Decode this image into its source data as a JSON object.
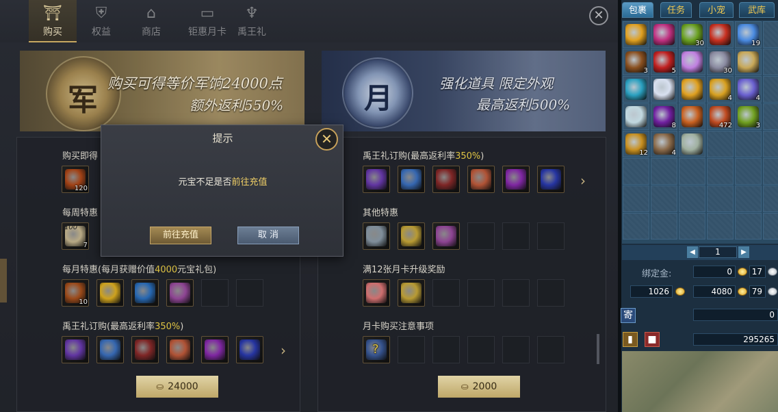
{
  "tabs": [
    {
      "label": "购买",
      "icon": "shop-gate-icon",
      "active": true
    },
    {
      "label": "权益",
      "icon": "shield-icon",
      "active": false
    },
    {
      "label": "商店",
      "icon": "store-icon",
      "active": false
    },
    {
      "label": "钜惠月卡",
      "icon": "card-icon",
      "active": false
    },
    {
      "label": "禹王礼",
      "icon": "trident-icon",
      "active": false
    }
  ],
  "banners": [
    {
      "line1": "购买可得等价军饷24000点",
      "line2": "额外返利550%",
      "glyph": "军"
    },
    {
      "line1": "强化道具 限定外观",
      "line2": "最高返利500%",
      "glyph": "月"
    }
  ],
  "left": {
    "sec1": "购买即得",
    "sec2": "每周特惠",
    "sec3_pre": "每月特惠(每月获赠价值",
    "sec3_hl": "4000",
    "sec3_post": "元宝礼包)",
    "sec4_pre": "禹王礼订购(最高返利率",
    "sec4_hl": "350%",
    "sec4_post": ")",
    "price": "24000",
    "items_r1": [
      {
        "color": "#b04818",
        "count": "120"
      }
    ],
    "items_r2": [
      {
        "color": "#c8b890",
        "count": "7",
        "top": "100"
      }
    ],
    "items_r3": [
      {
        "color": "#a8501c",
        "count": "10"
      },
      {
        "color": "#e0b020",
        "count": ""
      },
      {
        "color": "#2a70c0",
        "count": ""
      },
      {
        "color": "#9a4aa0",
        "count": ""
      }
    ],
    "items_r4": [
      {
        "color": "#6a3ab0"
      },
      {
        "color": "#3a70c0"
      },
      {
        "color": "#8a2a2a"
      },
      {
        "color": "#c05a3a"
      },
      {
        "color": "#8a2ab0"
      },
      {
        "color": "#2a3ab0"
      }
    ]
  },
  "right": {
    "sec1_pre": "禹王礼订购(最高返利率",
    "sec1_hl": "350%",
    "sec1_post": ")",
    "sec2": "其他特惠",
    "sec3": "满12张月卡升级奖励",
    "sec4": "月卡购买注意事项",
    "price": "2000",
    "items_r1": [
      {
        "color": "#6a3ab0"
      },
      {
        "color": "#3a70c0"
      },
      {
        "color": "#8a2a2a"
      },
      {
        "color": "#c05a3a"
      },
      {
        "color": "#8a2ab0"
      },
      {
        "color": "#2a3ab0"
      }
    ],
    "items_r2": [
      {
        "color": "#8a9aa8"
      },
      {
        "color": "#c8a838"
      },
      {
        "color": "#9a4aa0"
      }
    ],
    "items_r3": [
      {
        "color": "#e07878"
      },
      {
        "color": "#c8a838"
      }
    ],
    "items_r4": [
      {
        "color": "#3a5a9a",
        "glyph": "?"
      }
    ]
  },
  "dialog": {
    "title": "提示",
    "msg_pre": "元宝不足是否",
    "msg_hl": "前往充值",
    "ok": "前往充值",
    "cancel": "取 消"
  },
  "side": {
    "tabs": [
      "包裹",
      "任务",
      "小宠",
      "武库"
    ],
    "items": [
      {
        "color": "#e0a020",
        "count": ""
      },
      {
        "color": "#c03080",
        "count": ""
      },
      {
        "color": "#6aa020",
        "count": "30"
      },
      {
        "color": "#c83020",
        "count": ""
      },
      {
        "color": "#4a8ae0",
        "count": "19"
      },
      {
        "color": "#8a5020",
        "count": "3"
      },
      {
        "color": "#c02020",
        "count": "5"
      },
      {
        "color": "#c080e0",
        "count": ""
      },
      {
        "color": "#8a8aa0",
        "count": "30"
      },
      {
        "color": "#c8a858",
        "count": ""
      },
      {
        "color": "#2aa0c0",
        "count": ""
      },
      {
        "color": "#d8e0f0",
        "count": ""
      },
      {
        "color": "#e0a020",
        "count": ""
      },
      {
        "color": "#d8a020",
        "count": "4"
      },
      {
        "color": "#6a60d0",
        "count": "4"
      },
      {
        "color": "#c0d8e0",
        "count": ""
      },
      {
        "color": "#7020a0",
        "count": "8"
      },
      {
        "color": "#c86020",
        "count": ""
      },
      {
        "color": "#c04a20",
        "count": "472"
      },
      {
        "color": "#70a020",
        "count": "3"
      },
      {
        "color": "#c89020",
        "count": "12"
      },
      {
        "color": "#8a6a4a",
        "count": "4"
      },
      {
        "color": "#a0b0a0",
        "count": ""
      }
    ],
    "page": "1",
    "bind_label": "绑定金:",
    "bind_gold": "0",
    "bind_silver": "17",
    "gold": "1026",
    "money": "4080",
    "money_silver": "79",
    "ji_label": "寄",
    "ji_value": "0",
    "last_value": "295265"
  }
}
